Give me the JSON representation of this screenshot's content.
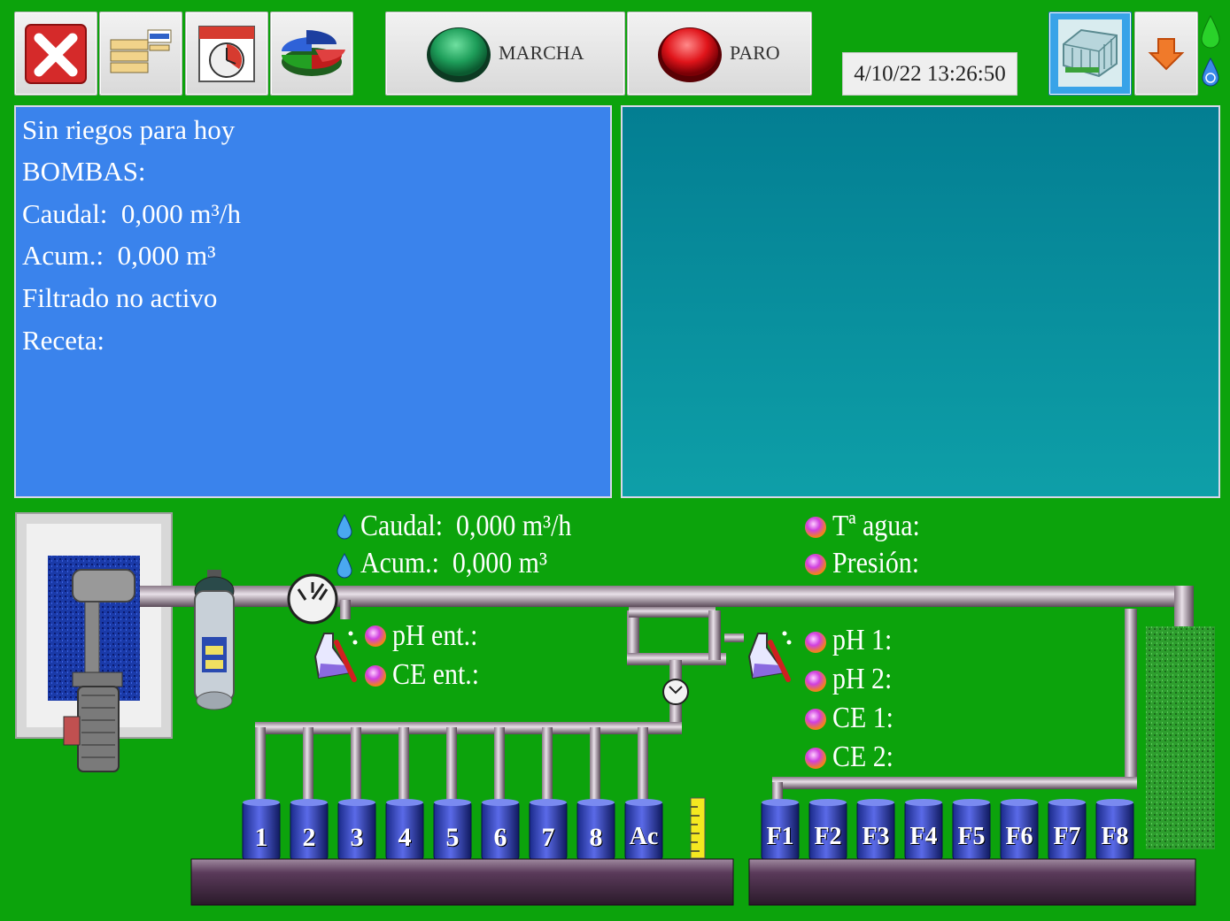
{
  "toolbar": {
    "marcha_label": "MARCHA",
    "paro_label": "PARO",
    "datetime": "4/10/22 13:26:50"
  },
  "status_panel": {
    "lines": [
      "Sin riegos para hoy",
      "BOMBAS:",
      "Caudal:  0,000 m³/h",
      "Acum.:  0,000 m³",
      "Filtrado no activo",
      "Receta:"
    ]
  },
  "diagram": {
    "caudal": "Caudal:  0,000 m³/h",
    "acum": "Acum.:  0,000 m³",
    "temp_agua": "Tª agua:",
    "presion": "Presión:",
    "ph_ent": "pH ent.:",
    "ce_ent": "CE ent.:",
    "ph1": "pH 1:",
    "ph2": "pH 2:",
    "ce1": "CE 1:",
    "ce2": "CE 2:",
    "tanks_left": [
      "1",
      "2",
      "3",
      "4",
      "5",
      "6",
      "7",
      "8",
      "Ac"
    ],
    "tanks_right": [
      "F1",
      "F2",
      "F3",
      "F4",
      "F5",
      "F6",
      "F7",
      "F8"
    ]
  },
  "colors": {
    "background": "#0ca30c",
    "status_panel": "#3a83ec",
    "right_panel": "#037e92",
    "marcha": "#1e9e5a",
    "paro": "#e0141a"
  }
}
